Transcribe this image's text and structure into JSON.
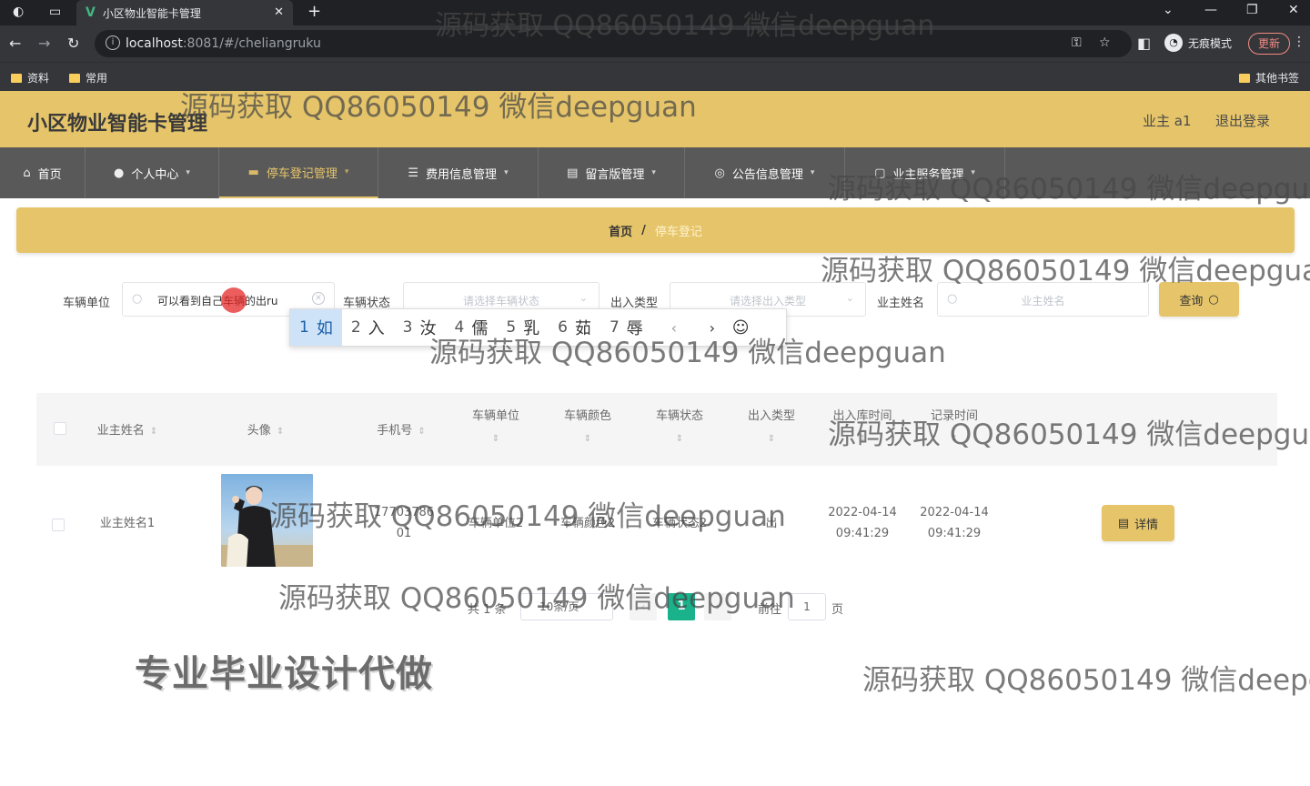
{
  "browser": {
    "tab_title": "小区物业智能卡管理",
    "url_host": "localhost",
    "url_rest": ":8081/#/cheliangruku",
    "incognito_label": "无痕模式",
    "update_label": "更新",
    "bookmarks": [
      "资料",
      "常用"
    ],
    "other_bookmarks": "其他书签"
  },
  "header": {
    "title": "小区物业智能卡管理",
    "user": "业主 a1",
    "logout": "退出登录"
  },
  "nav": [
    {
      "label": "首页",
      "icon": "home-icon"
    },
    {
      "label": "个人中心",
      "icon": "user-icon"
    },
    {
      "label": "停车登记管理",
      "icon": "parking-icon",
      "active": true
    },
    {
      "label": "费用信息管理",
      "icon": "list-icon"
    },
    {
      "label": "留言版管理",
      "icon": "message-icon"
    },
    {
      "label": "公告信息管理",
      "icon": "notice-icon"
    },
    {
      "label": "业主服务管理",
      "icon": "service-icon"
    }
  ],
  "breadcrumb": {
    "home": "首页",
    "sep": "/",
    "current": "停车登记"
  },
  "search": {
    "unit_label": "车辆单位",
    "unit_value": "可以看到自己车辆的出ru",
    "status_label": "车辆状态",
    "status_placeholder": "请选择车辆状态",
    "type_label": "出入类型",
    "type_placeholder": "请选择出入类型",
    "owner_label": "业主姓名",
    "owner_placeholder": "业主姓名",
    "query_button": "查询"
  },
  "ime": {
    "candidates": [
      {
        "n": "1",
        "t": "如"
      },
      {
        "n": "2",
        "t": "入"
      },
      {
        "n": "3",
        "t": "汝"
      },
      {
        "n": "4",
        "t": "儒"
      },
      {
        "n": "5",
        "t": "乳"
      },
      {
        "n": "6",
        "t": "茹"
      },
      {
        "n": "7",
        "t": "辱"
      }
    ]
  },
  "table": {
    "headers": [
      "业主姓名",
      "头像",
      "手机号",
      "车辆单位",
      "车辆颜色",
      "车辆状态",
      "出入类型",
      "出入库时间",
      "记录时间"
    ],
    "rows": [
      {
        "owner": "业主姓名1",
        "phone_1": "17703786",
        "phone_2": "01",
        "unit": "车辆单位2",
        "color": "车辆颜色2",
        "status": "车辆状态2",
        "type": "出",
        "io_date": "2022-04-14",
        "io_time": "09:41:29",
        "rec_date": "2022-04-14",
        "rec_time": "09:41:29",
        "action": "详情"
      }
    ]
  },
  "pagination": {
    "total": "共 1 条",
    "page_size": "10条/页",
    "current": "1",
    "goto_label": "前往",
    "goto_value": "1",
    "page_suffix": "页"
  },
  "promo": "专业毕业设计代做",
  "watermark": "源码获取 QQ86050149 微信deepguan"
}
